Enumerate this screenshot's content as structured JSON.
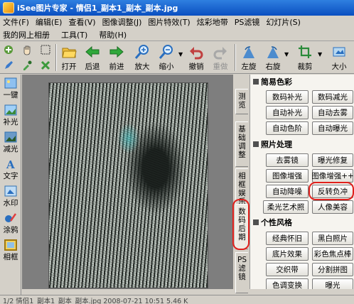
{
  "window": {
    "title": "iSee图片专家 - 情侣1_副本1_副本_副本.jpg"
  },
  "menu": [
    "文件(F)",
    "编辑(E)",
    "查看(V)",
    "图像调整(J)",
    "图片特效(T)",
    "炫彩地带",
    "PS滤镜",
    "幻灯片(S)"
  ],
  "menu2": [
    "我的网上相册",
    "工具(T)",
    "帮助(H)"
  ],
  "toolbar": {
    "open": "打开",
    "back": "后退",
    "forward": "前进",
    "zoom_in": "放大",
    "zoom_out": "缩小",
    "undo": "撤销",
    "redo": "重做",
    "rotate_left": "左旋",
    "rotate_right": "右旋",
    "crop": "裁剪",
    "size": "大小"
  },
  "leftbar": [
    "一键",
    "补光",
    "减光",
    "文字",
    "水印",
    "涂鸦",
    "相框"
  ],
  "vtabs": [
    "测览",
    "基础调整",
    "相框娱乐",
    "数码后期",
    "PS滤镜"
  ],
  "panel": {
    "section1": "简易色彩",
    "s1_buttons": [
      "数码补光",
      "数码减光",
      "自动补光",
      "自动去雾",
      "自动色阶",
      "自动曝光"
    ],
    "section2": "照片处理",
    "s2_buttons": [
      "去雾镜",
      "曝光修复",
      "图像增强",
      "图像增强++",
      "自动降噪",
      "反转负冲",
      "柔光艺术照",
      "人像美容"
    ],
    "section3": "个性风格",
    "s3_buttons": [
      "经典怀旧",
      "黑白照片",
      "底片效果",
      "彩色焦点棒",
      "交织带",
      "分割拼图",
      "色调变换",
      "曝光"
    ]
  },
  "status": "1/2  情侣1_副本1_副本_副本.jpg  2008-07-21 10:51  5.46 K"
}
